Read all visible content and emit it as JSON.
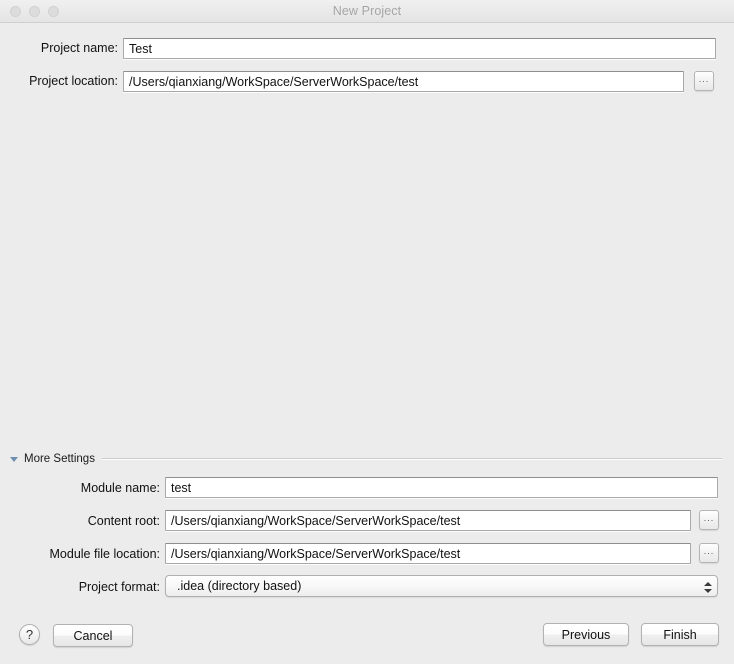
{
  "window": {
    "title": "New Project",
    "traffic_lights": [
      "close-button",
      "minimize-button",
      "zoom-button"
    ]
  },
  "top_form": {
    "project_name": {
      "label": "Project name:",
      "value": "Test",
      "placeholder": ""
    },
    "project_location": {
      "label": "Project location:",
      "value": "/Users/qianxiang/WorkSpace/ServerWorkSpace/test",
      "placeholder": "",
      "browse_label": "..."
    }
  },
  "more_settings": {
    "label": "More Settings",
    "expanded": true,
    "disclosure_icon": "triangle-down-icon",
    "module_name": {
      "label": "Module name:",
      "value": "test",
      "placeholder": ""
    },
    "content_root": {
      "label": "Content root:",
      "value": "/Users/qianxiang/WorkSpace/ServerWorkSpace/test",
      "placeholder": "",
      "browse_label": "..."
    },
    "module_file_location": {
      "label": "Module file location:",
      "value": "/Users/qianxiang/WorkSpace/ServerWorkSpace/test",
      "placeholder": "",
      "browse_label": "..."
    },
    "project_format": {
      "label": "Project format:",
      "value": ".idea (directory based)",
      "options": [
        ".idea (directory based)"
      ]
    }
  },
  "footer": {
    "help_label": "?",
    "cancel_label": "Cancel",
    "previous_label": "Previous",
    "finish_label": "Finish"
  },
  "colors": {
    "background": "#ececec",
    "titlebar": "#eaeaea",
    "title_text": "#a6a6a6",
    "field_border": "#a9a9a9",
    "disclosure": "#6f8fae"
  }
}
